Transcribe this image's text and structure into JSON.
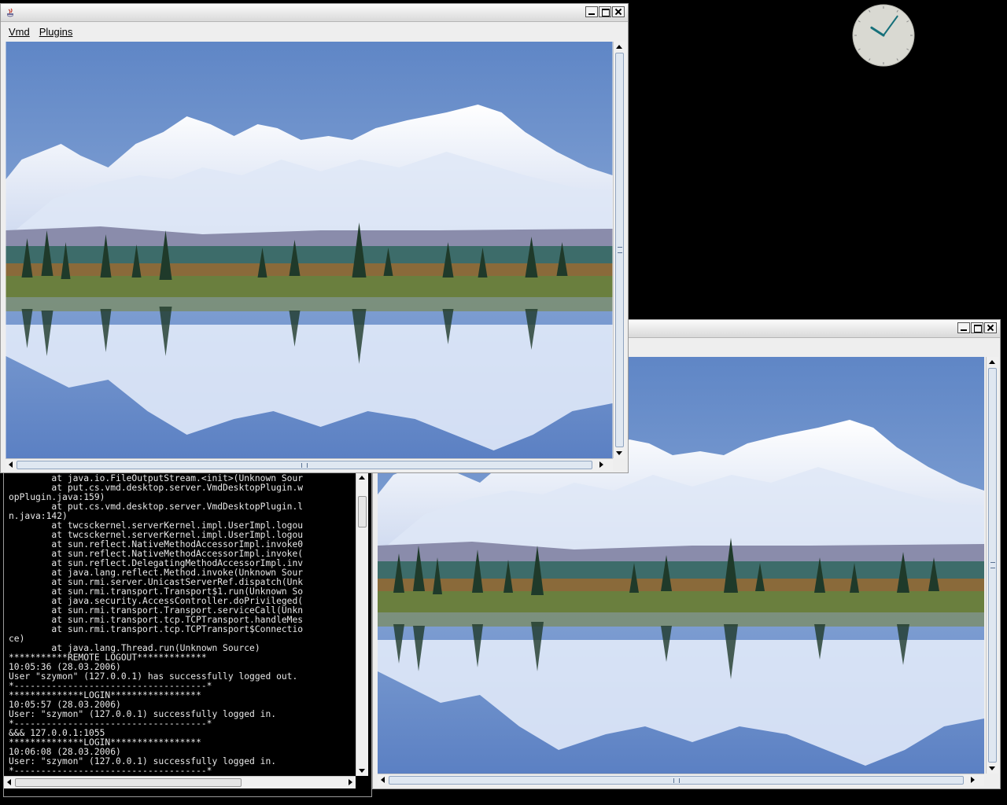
{
  "main_window": {
    "menu": [
      "Vmd",
      "Plugins"
    ],
    "controls": {
      "minimize_icon": "minimize-icon",
      "maximize_icon": "maximize-icon",
      "close_icon": "close-icon"
    }
  },
  "second_window": {
    "controls": {
      "minimize_icon": "minimize-icon",
      "maximize_icon": "maximize-icon",
      "close_icon": "close-icon"
    }
  },
  "remote_screen_image": "mountain-lake-reflection",
  "console": {
    "lines": [
      "        at java.io.FileOutputStream.<init>(Unknown Sour",
      "        at put.cs.vmd.desktop.server.VmdDesktopPlugin.w",
      "opPlugin.java:159)",
      "        at put.cs.vmd.desktop.server.VmdDesktopPlugin.l",
      "n.java:142)",
      "        at twcsckernel.serverKernel.impl.UserImpl.logou",
      "        at twcsckernel.serverKernel.impl.UserImpl.logou",
      "        at sun.reflect.NativeMethodAccessorImpl.invoke0",
      "        at sun.reflect.NativeMethodAccessorImpl.invoke(",
      "        at sun.reflect.DelegatingMethodAccessorImpl.inv",
      "        at java.lang.reflect.Method.invoke(Unknown Sour",
      "        at sun.rmi.server.UnicastServerRef.dispatch(Unk",
      "        at sun.rmi.transport.Transport$1.run(Unknown So",
      "        at java.security.AccessController.doPrivileged(",
      "        at sun.rmi.transport.Transport.serviceCall(Unkn",
      "        at sun.rmi.transport.tcp.TCPTransport.handleMes",
      "        at sun.rmi.transport.tcp.TCPTransport$Connectio",
      "ce)",
      "        at java.lang.Thread.run(Unknown Source)",
      "***********REMOTE LOGOUT*************",
      "10:05:36 (28.03.2006)",
      "User \"szymon\" (127.0.0.1) has successfully logged out.",
      "*------------------------------------*",
      "**************LOGIN*****************",
      "10:05:57 (28.03.2006)",
      "User: \"szymon\" (127.0.0.1) successfully logged in.",
      "*------------------------------------*",
      "&&& 127.0.0.1:1055",
      "**************LOGIN*****************",
      "10:06:08 (28.03.2006)",
      "User: \"szymon\" (127.0.0.1) successfully logged in.",
      "*------------------------------------*"
    ]
  },
  "clock": {
    "hour": 10,
    "minute": 6
  },
  "colors": {
    "desktop": "#000000",
    "window_bg": "#eeeeee",
    "console_bg": "#000000",
    "console_text": "#e8e8e8",
    "clock_hands": "#16707a"
  }
}
